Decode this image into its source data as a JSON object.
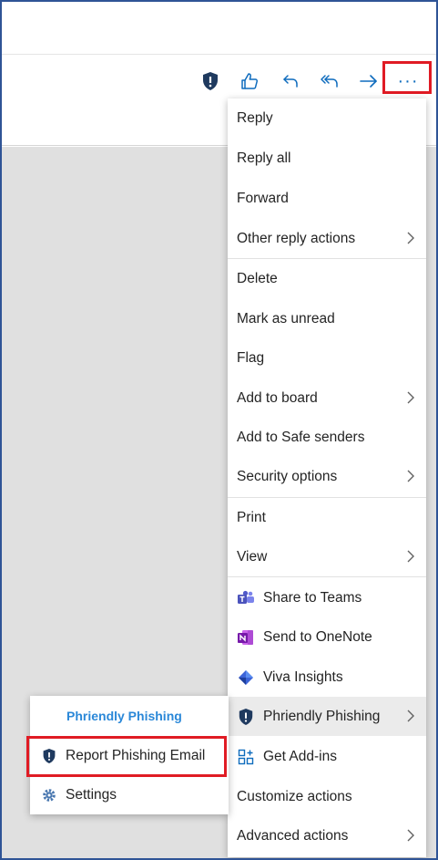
{
  "toolbar": {
    "icons": [
      "phriendly-phishing-shield-icon",
      "like-icon",
      "reply-icon",
      "reply-all-icon",
      "forward-icon",
      "more-actions-icon"
    ],
    "more_label": "···"
  },
  "menu": {
    "items": [
      {
        "label": "Reply"
      },
      {
        "label": "Reply all"
      },
      {
        "label": "Forward"
      },
      {
        "label": "Other reply actions",
        "submenu": true
      },
      {
        "label": "Delete"
      },
      {
        "label": "Mark as unread"
      },
      {
        "label": "Flag"
      },
      {
        "label": "Add to board",
        "submenu": true
      },
      {
        "label": "Add to Safe senders"
      },
      {
        "label": "Security options",
        "submenu": true
      },
      {
        "label": "Print"
      },
      {
        "label": "View",
        "submenu": true
      },
      {
        "label": "Share to Teams",
        "icon": "teams-icon"
      },
      {
        "label": "Send to OneNote",
        "icon": "onenote-icon"
      },
      {
        "label": "Viva Insights",
        "icon": "viva-insights-icon"
      },
      {
        "label": "Phriendly Phishing",
        "icon": "phriendly-phishing-shield-icon",
        "submenu": true
      },
      {
        "label": "Get Add-ins",
        "icon": "add-ins-icon"
      },
      {
        "label": "Customize actions"
      },
      {
        "label": "Advanced actions",
        "submenu": true
      }
    ]
  },
  "submenu": {
    "title": "Phriendly Phishing",
    "items": [
      {
        "label": "Report Phishing Email",
        "icon": "phriendly-phishing-shield-icon"
      },
      {
        "label": "Settings",
        "icon": "gear-icon"
      }
    ]
  },
  "colors": {
    "accent": "#0f6cbd",
    "highlight": "#e01b24",
    "shield": "#1f3a5f",
    "submenu_title": "#2b88d8"
  }
}
